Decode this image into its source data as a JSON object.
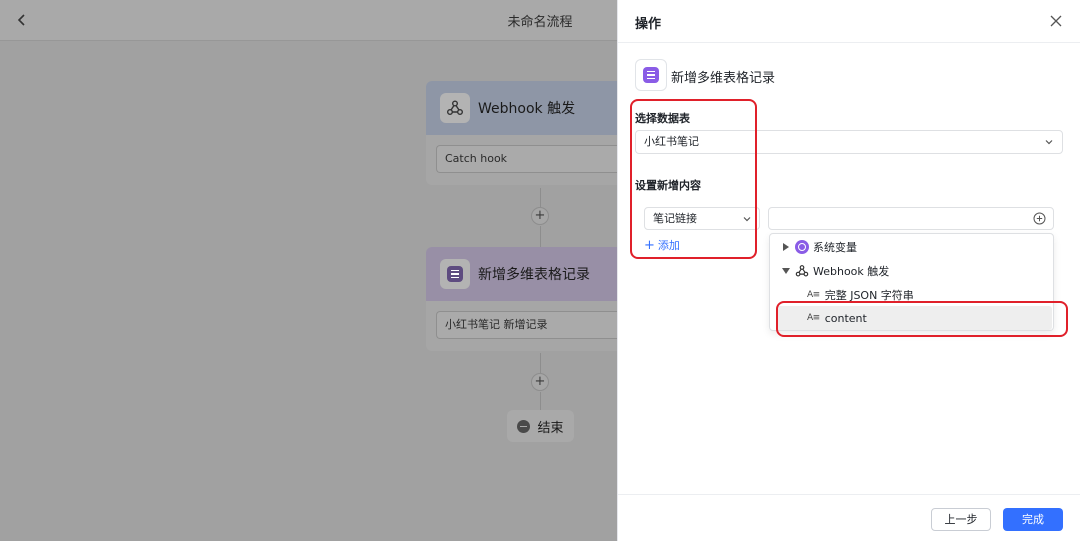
{
  "flow": {
    "title": "未命名流程",
    "webhook_node": {
      "title": "Webhook 触发",
      "field": "Catch hook"
    },
    "table_node": {
      "title": "新增多维表格记录",
      "field": "小红书笔记 新增记录"
    },
    "add_symbol": "+",
    "end_label": "结束"
  },
  "drawer": {
    "title": "操作",
    "action_name": "新增多维表格记录",
    "select_table_label": "选择数据表",
    "selected_table": "小红书笔记",
    "set_content_label": "设置新增内容",
    "field_name": "笔记链接",
    "add_label": "添加",
    "dropdown": {
      "system_vars": "系统变量",
      "webhook_group": "Webhook 触发",
      "full_json": "完整 JSON 字符串",
      "content": "content"
    },
    "prev_button": "上一步",
    "done_button": "完成"
  },
  "colors": {
    "accent": "#3370ff",
    "purple": "#8a5ce6",
    "highlight_red": "#e0202a"
  }
}
